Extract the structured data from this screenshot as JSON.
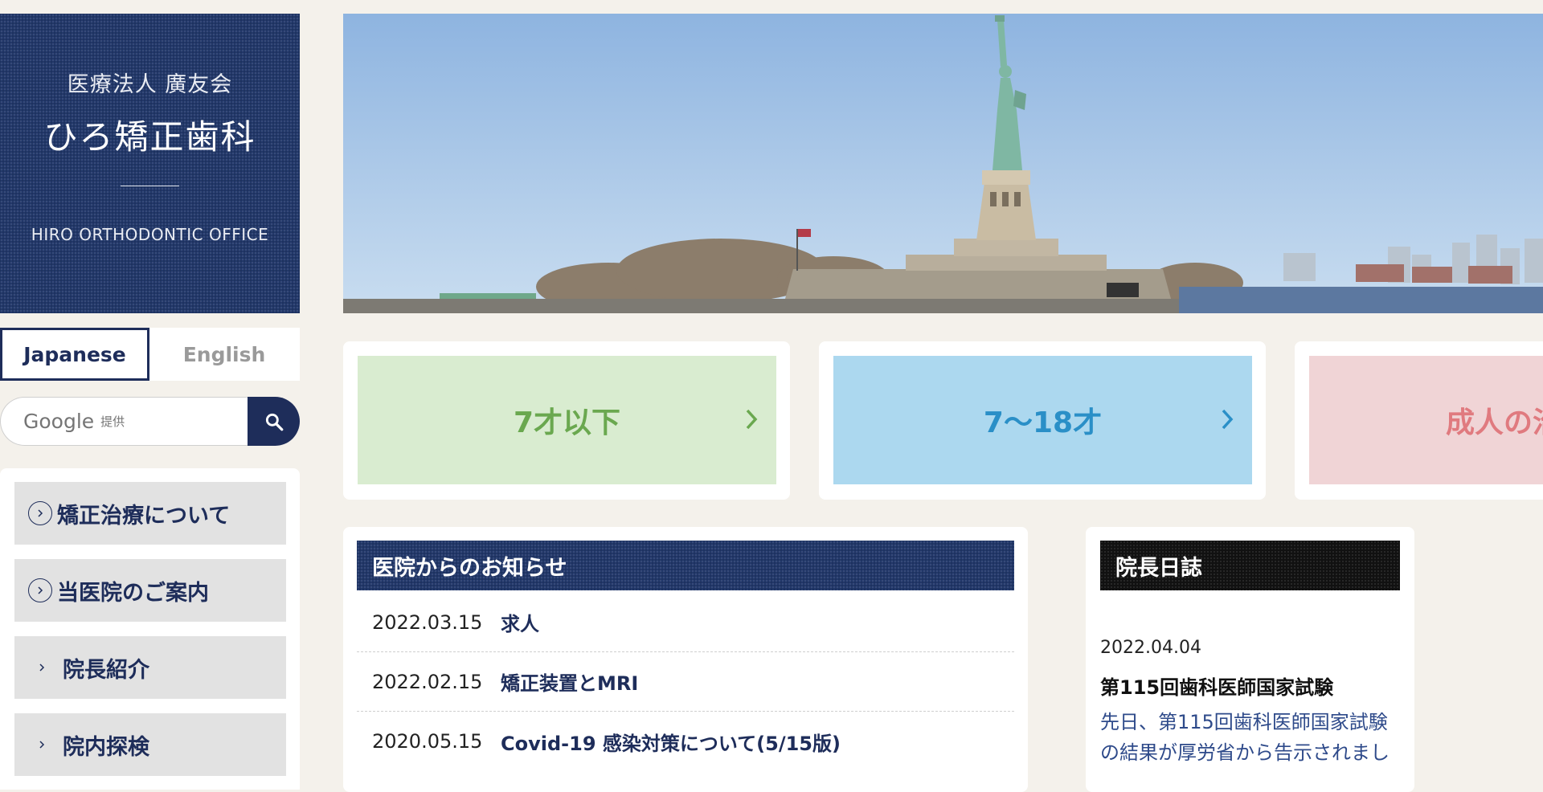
{
  "sidebar": {
    "logo": {
      "corporation": "医療法人 廣友会",
      "clinic_name": "ひろ矯正歯科",
      "english_name": "HIRO ORTHODONTIC OFFICE"
    },
    "language_tabs": [
      {
        "label": "Japanese",
        "active": true
      },
      {
        "label": "English",
        "active": false
      }
    ],
    "search": {
      "google_label": "Google",
      "provided_label": "提供"
    },
    "nav_items": [
      {
        "label": "矯正治療について",
        "icon": "circle-chevron-right-icon"
      },
      {
        "label": "当医院のご案内",
        "icon": "circle-chevron-right-icon"
      },
      {
        "label": "院長紹介",
        "icon": "chevron-right-icon"
      },
      {
        "label": "院内探検",
        "icon": "chevron-right-icon"
      }
    ]
  },
  "hero": {
    "image": "statue-of-liberty-harbor-photo"
  },
  "categories": [
    {
      "label": "7才以下",
      "bg": "#d9ecd0",
      "color": "#6aa84f"
    },
    {
      "label": "7〜18才",
      "bg": "#acd8ef",
      "color": "#2a8fc7"
    },
    {
      "label": "成人の治療",
      "bg": "#f0d4d6",
      "color": "#e07a7f"
    }
  ],
  "news": {
    "heading": "医院からのお知らせ",
    "items": [
      {
        "date": "2022.03.15",
        "title": "求人"
      },
      {
        "date": "2022.02.15",
        "title": "矯正装置とMRI"
      },
      {
        "date": "2020.05.15",
        "title": "Covid-19 感染対策について(5/15版)"
      }
    ]
  },
  "diary": {
    "heading": "院長日誌",
    "date": "2022.04.04",
    "title": "第115回歯科医師国家試験",
    "excerpt": "先日、第115回歯科医師国家試験の結果が厚労省から告示されまし"
  },
  "colors": {
    "navy": "#22386a",
    "background": "#f4f1eb"
  }
}
